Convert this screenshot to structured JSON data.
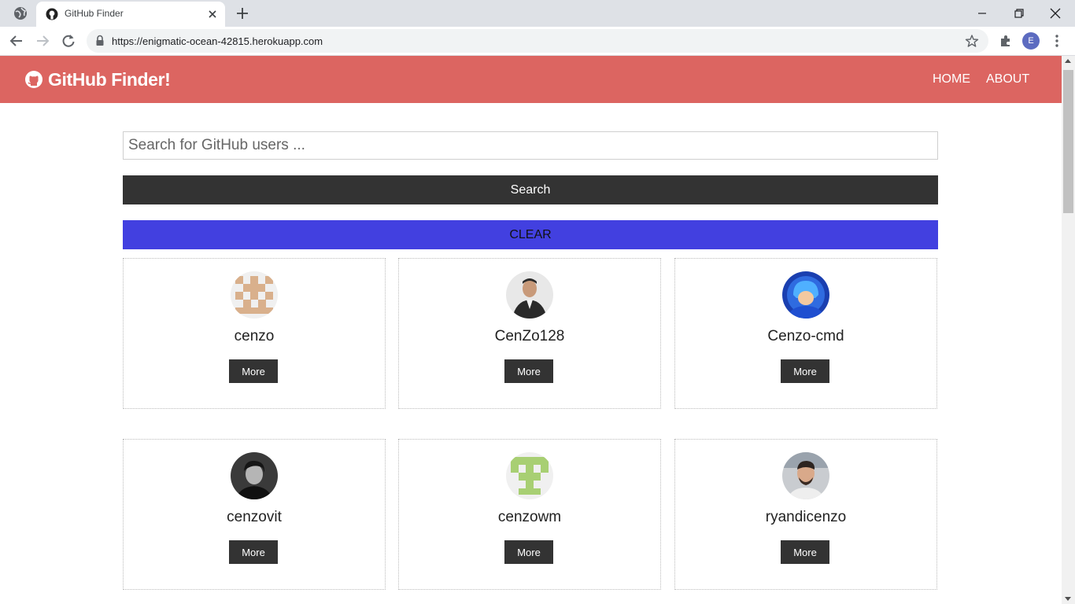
{
  "browser": {
    "tab_title": "GitHub Finder",
    "url": "https://enigmatic-ocean-42815.herokuapp.com",
    "profile_initial": "E"
  },
  "navbar": {
    "brand": "GitHub Finder!",
    "links": [
      "HOME",
      "ABOUT"
    ],
    "background": "#dc6561"
  },
  "search": {
    "placeholder": "Search for GitHub users ...",
    "value": "",
    "search_label": "Search",
    "clear_label": "CLEAR"
  },
  "colors": {
    "dark": "#333333",
    "clear": "#4240e0"
  },
  "users": [
    {
      "login": "cenzo",
      "more_label": "More",
      "avatar": "identicon-tan"
    },
    {
      "login": "CenZo128",
      "more_label": "More",
      "avatar": "photo-man-suit"
    },
    {
      "login": "Cenzo-cmd",
      "more_label": "More",
      "avatar": "photo-megaman"
    },
    {
      "login": "cenzovit",
      "more_label": "More",
      "avatar": "photo-man-bw"
    },
    {
      "login": "cenzowm",
      "more_label": "More",
      "avatar": "identicon-green"
    },
    {
      "login": "ryandicenzo",
      "more_label": "More",
      "avatar": "photo-man-smile"
    }
  ]
}
